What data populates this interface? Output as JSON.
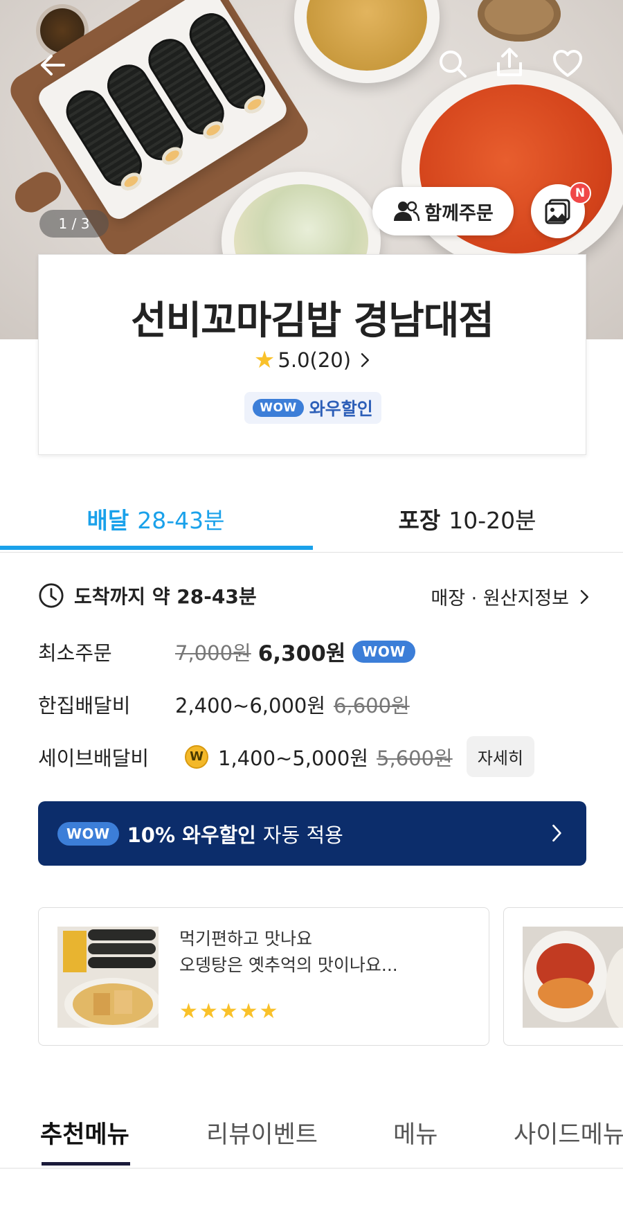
{
  "hero": {
    "image_counter": "1 / 3",
    "together_order_label": "함께주문",
    "photo_badge": "N"
  },
  "store": {
    "name": "선비꼬마김밥 경남대점",
    "rating": "5.0(20)",
    "wow_tag": "WOW",
    "wow_discount_label": "와우할인"
  },
  "delivery_tabs": [
    {
      "label": "배달",
      "time": "28-43분",
      "active": true
    },
    {
      "label": "포장",
      "time": "10-20분",
      "active": false
    }
  ],
  "details": {
    "arrival_label": "도착까지 약 28-43분",
    "store_info_link": "매장 · 원산지정보",
    "min_order": {
      "label": "최소주문",
      "original": "7,000원",
      "price": "6,300원",
      "tag": "WOW"
    },
    "single_delivery": {
      "label": "한집배달비",
      "price": "2,400~6,000원",
      "original": "6,600원"
    },
    "saver_delivery": {
      "label": "세이브배달비",
      "price": "1,400~5,000원",
      "original": "5,600원",
      "detail_button": "자세히"
    }
  },
  "banner": {
    "tag": "WOW",
    "highlight": "10% 와우할인",
    "text": "자동 적용"
  },
  "reviews": [
    {
      "line1": "먹기편하고 맛나요",
      "line2": "오뎅탕은  옛추억의 맛이나요...",
      "stars": "★★★★★",
      "rating_value": 5
    }
  ],
  "menu_tabs": [
    {
      "label": "추천메뉴",
      "active": true
    },
    {
      "label": "리뷰이벤트",
      "active": false
    },
    {
      "label": "메뉴",
      "active": false
    },
    {
      "label": "사이드메뉴",
      "active": false
    }
  ],
  "colors": {
    "accent_blue": "#1aa1ea",
    "wow_blue": "#3c7ed8",
    "banner_navy": "#0c2d6b",
    "star_yellow": "#f9c12a",
    "badge_red": "#f04747"
  },
  "icons": {
    "back": "arrow-left-icon",
    "search": "search-icon",
    "share": "share-icon",
    "favorite": "heart-icon",
    "clock": "clock-icon",
    "coin": "coin-icon"
  }
}
